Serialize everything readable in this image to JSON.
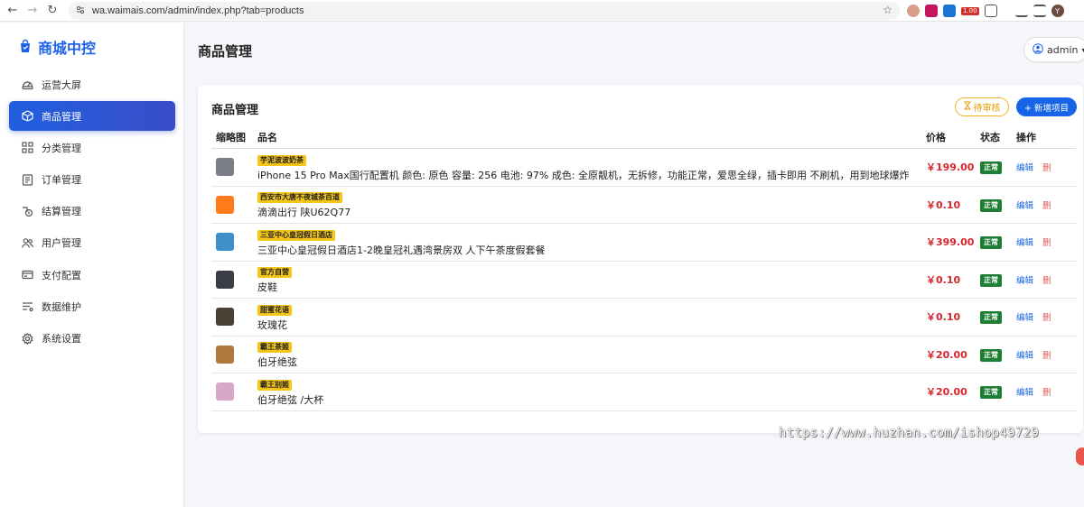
{
  "browser": {
    "url": "wa.waimais.com/admin/index.php?tab=products",
    "ext_badge": "1.00",
    "profile_initial": "Y"
  },
  "sidebar": {
    "brand": "商城中控",
    "items": [
      {
        "label": "运营大屏",
        "icon": "dashboard-icon"
      },
      {
        "label": "商品管理",
        "icon": "box-icon",
        "active": true
      },
      {
        "label": "分类管理",
        "icon": "grid-icon"
      },
      {
        "label": "订单管理",
        "icon": "order-list-icon"
      },
      {
        "label": "结算管理",
        "icon": "settlement-icon"
      },
      {
        "label": "用户管理",
        "icon": "users-icon"
      },
      {
        "label": "支付配置",
        "icon": "credit-card-icon"
      },
      {
        "label": "数据维护",
        "icon": "data-icon"
      },
      {
        "label": "系统设置",
        "icon": "gear-icon"
      }
    ]
  },
  "header": {
    "title": "商品管理",
    "user": "admin"
  },
  "card": {
    "title": "商品管理",
    "pending_label": "待审核",
    "add_label": "+ 新增项目"
  },
  "table": {
    "columns": {
      "thumb": "缩略图",
      "name": "品名",
      "price": "价格",
      "status": "状态",
      "ops": "操作"
    },
    "edit_label": "编辑",
    "delete_label": "删",
    "rows": [
      {
        "tag": "芋泥波波奶茶",
        "name": "iPhone 15 Pro Max国行配置机 颜色: 原色 容量: 256 电池: 97% 成色: 全原靓机，无拆修，功能正常，爱思全绿，插卡即用 不刷机，用到地球爆炸",
        "price": "￥199.00",
        "status": "正常",
        "thumb_color": "#7a7f86"
      },
      {
        "tag": "西安市大唐不夜城茶百道",
        "name": "滴滴出行 陕U62Q77",
        "price": "￥0.10",
        "status": "正常",
        "thumb_color": "#ff7a1a"
      },
      {
        "tag": "三亚中心皇冠假日酒店",
        "name": "三亚中心皇冠假日酒店1-2晚皇冠礼遇湾景房双 人下午茶度假套餐",
        "price": "￥399.00",
        "status": "正常",
        "thumb_color": "#3f8fc9"
      },
      {
        "tag": "官方自营",
        "name": "皮鞋",
        "price": "￥0.10",
        "status": "正常",
        "thumb_color": "#3a3d44"
      },
      {
        "tag": "甜蜜花语",
        "name": "玫瑰花",
        "price": "￥0.10",
        "status": "正常",
        "thumb_color": "#4a4036"
      },
      {
        "tag": "霸王茶姬",
        "name": "伯牙绝弦",
        "price": "￥20.00",
        "status": "正常",
        "thumb_color": "#b07a3e"
      },
      {
        "tag": "霸王别姬",
        "name": "伯牙绝弦 /大杯",
        "price": "￥20.00",
        "status": "正常",
        "thumb_color": "#d9a7c7"
      }
    ]
  },
  "watermark": "https://www.huzhan.com/ishop49729"
}
